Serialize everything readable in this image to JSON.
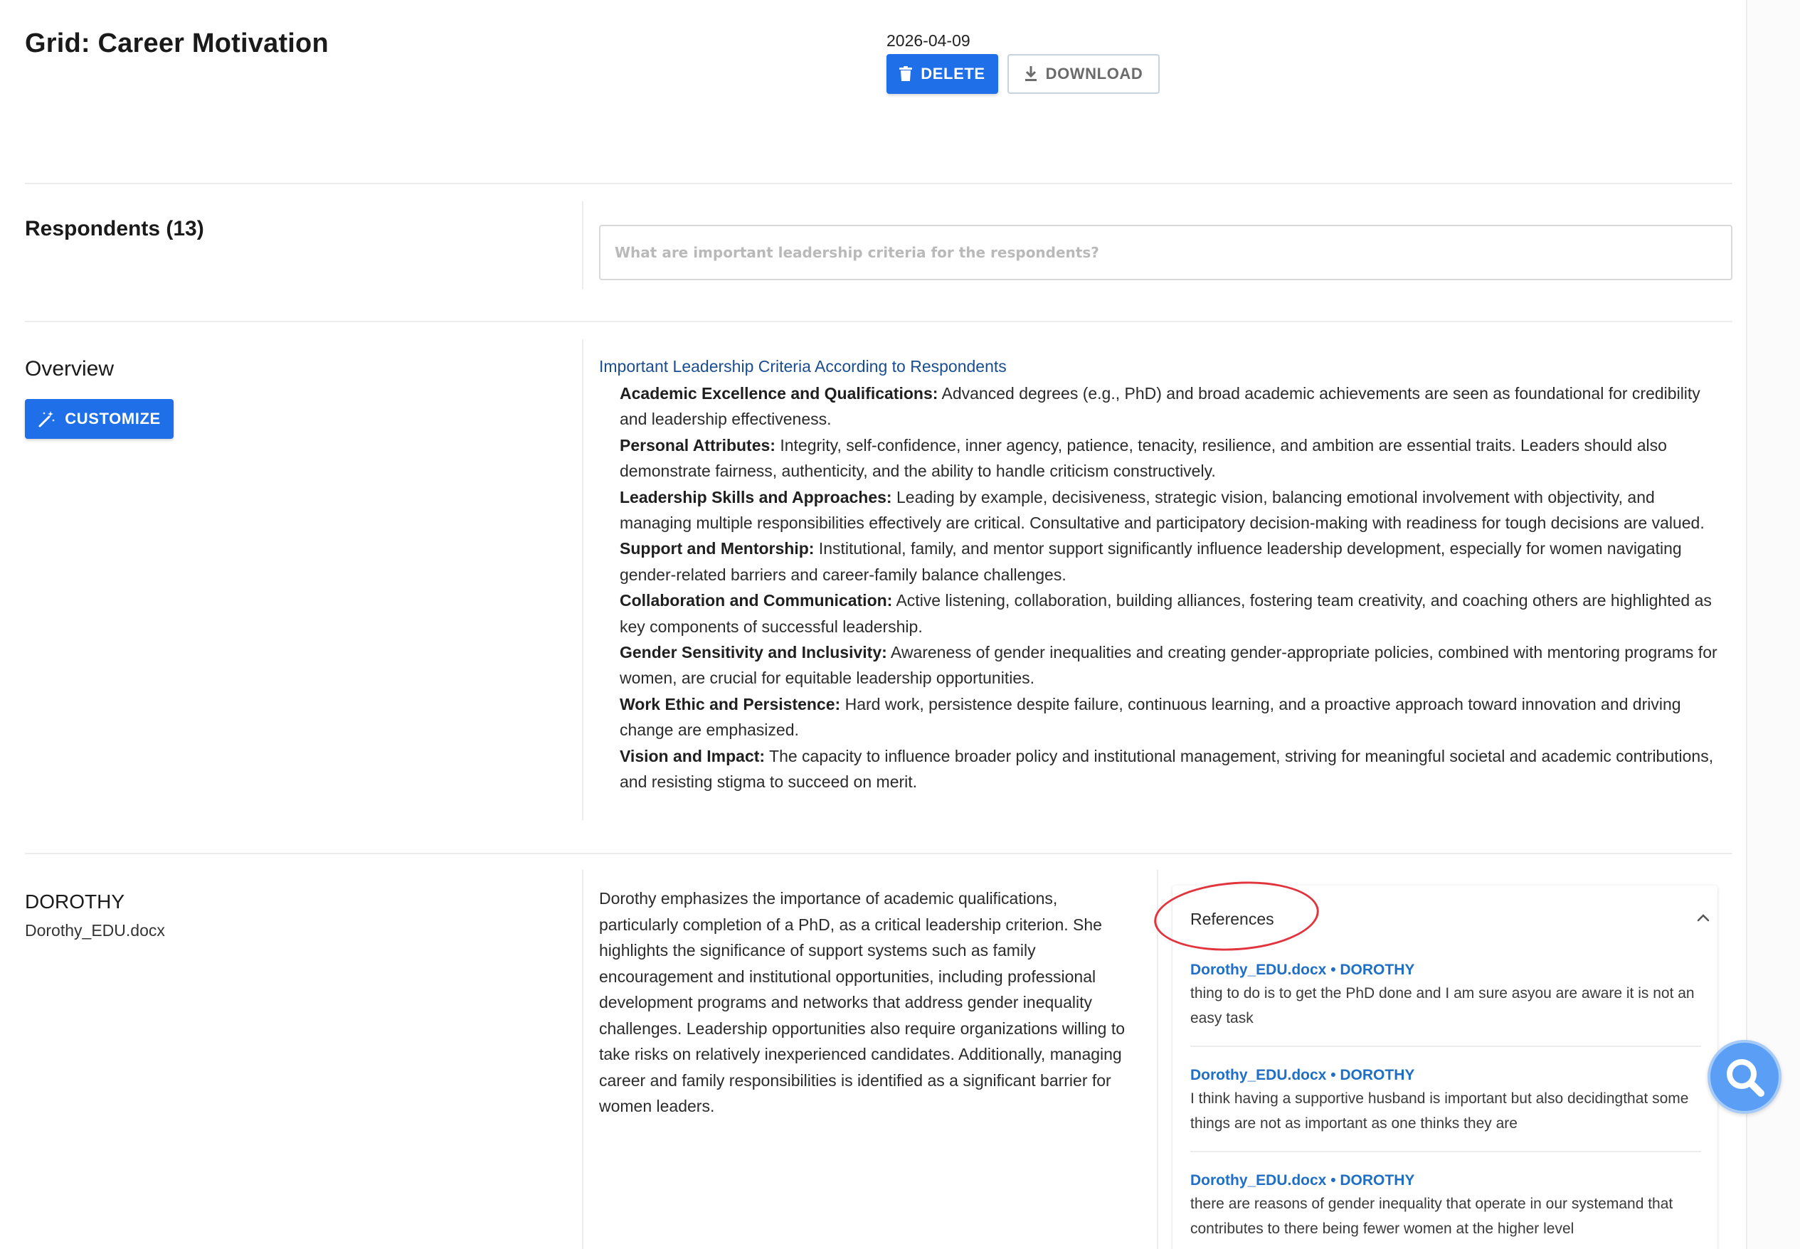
{
  "header": {
    "title": "Grid: Career Motivation",
    "date": "2026-04-09",
    "delete_label": "DELETE",
    "download_label": "DOWNLOAD"
  },
  "respondents": {
    "heading": "Respondents (13)",
    "search_placeholder": "What are important leadership criteria for the respondents?"
  },
  "overview": {
    "label": "Overview",
    "customize_label": "CUSTOMIZE",
    "heading": "Important Leadership Criteria According to Respondents",
    "criteria": [
      {
        "term": "Academic Excellence and Qualifications:",
        "text": " Advanced degrees (e.g., PhD) and broad academic achievements are seen as foundational for credibility and leadership effectiveness."
      },
      {
        "term": "Personal Attributes:",
        "text": " Integrity, self-confidence, inner agency, patience, tenacity, resilience, and ambition are essential traits. Leaders should also demonstrate fairness, authenticity, and the ability to handle criticism constructively."
      },
      {
        "term": "Leadership Skills and Approaches:",
        "text": " Leading by example, decisiveness, strategic vision, balancing emotional involvement with objectivity, and managing multiple responsibilities effectively are critical. Consultative and participatory decision-making with readiness for tough decisions are valued."
      },
      {
        "term": "Support and Mentorship:",
        "text": " Institutional, family, and mentor support significantly influence leadership development, especially for women navigating gender-related barriers and career-family balance challenges."
      },
      {
        "term": "Collaboration and Communication:",
        "text": " Active listening, collaboration, building alliances, fostering team creativity, and coaching others are highlighted as key components of successful leadership."
      },
      {
        "term": "Gender Sensitivity and Inclusivity:",
        "text": " Awareness of gender inequalities and creating gender-appropriate policies, combined with mentoring programs for women, are crucial for equitable leadership opportunities."
      },
      {
        "term": "Work Ethic and Persistence:",
        "text": " Hard work, persistence despite failure, continuous learning, and a proactive approach toward innovation and driving change are emphasized."
      },
      {
        "term": "Vision and Impact:",
        "text": " The capacity to influence broader policy and institutional management, striving for meaningful societal and academic contributions, and resisting stigma to succeed on merit."
      }
    ]
  },
  "respondent": {
    "name": "DOROTHY",
    "file": "Dorothy_EDU.docx",
    "summary": "Dorothy emphasizes the importance of academic qualifications, particularly completion of a PhD, as a critical leadership criterion. She highlights the significance of support systems such as family encouragement and institutional opportunities, including professional development programs and networks that address gender inequality challenges. Leadership opportunities also require organizations willing to take risks on relatively inexperienced candidates. Additionally, managing career and family responsibilities is identified as a significant barrier for women leaders."
  },
  "references": {
    "title": "References",
    "items": [
      {
        "source": "Dorothy_EDU.docx • DOROTHY",
        "quote": "thing to do is to get the PhD done and I am sure asyou are aware it is not an easy task"
      },
      {
        "source": "Dorothy_EDU.docx • DOROTHY",
        "quote": "I think having a supportive husband is important but also decidingthat some things are not as important as one thinks they are"
      },
      {
        "source": "Dorothy_EDU.docx • DOROTHY",
        "quote": "there are reasons of gender inequality that operate in our systemand that contributes to there being fewer women at the higher level"
      }
    ]
  },
  "colors": {
    "primary_button": "#1f6fe8",
    "link_blue": "#1f6fc6",
    "heading_blue": "#1a4d8f",
    "annotation_red": "#e2343c",
    "fab_blue": "#5b9ef5"
  },
  "icons": {
    "delete": "trash-icon",
    "download": "download-icon",
    "customize": "magic-wand-icon",
    "collapse": "chevron-up-icon",
    "fab": "search-icon"
  }
}
